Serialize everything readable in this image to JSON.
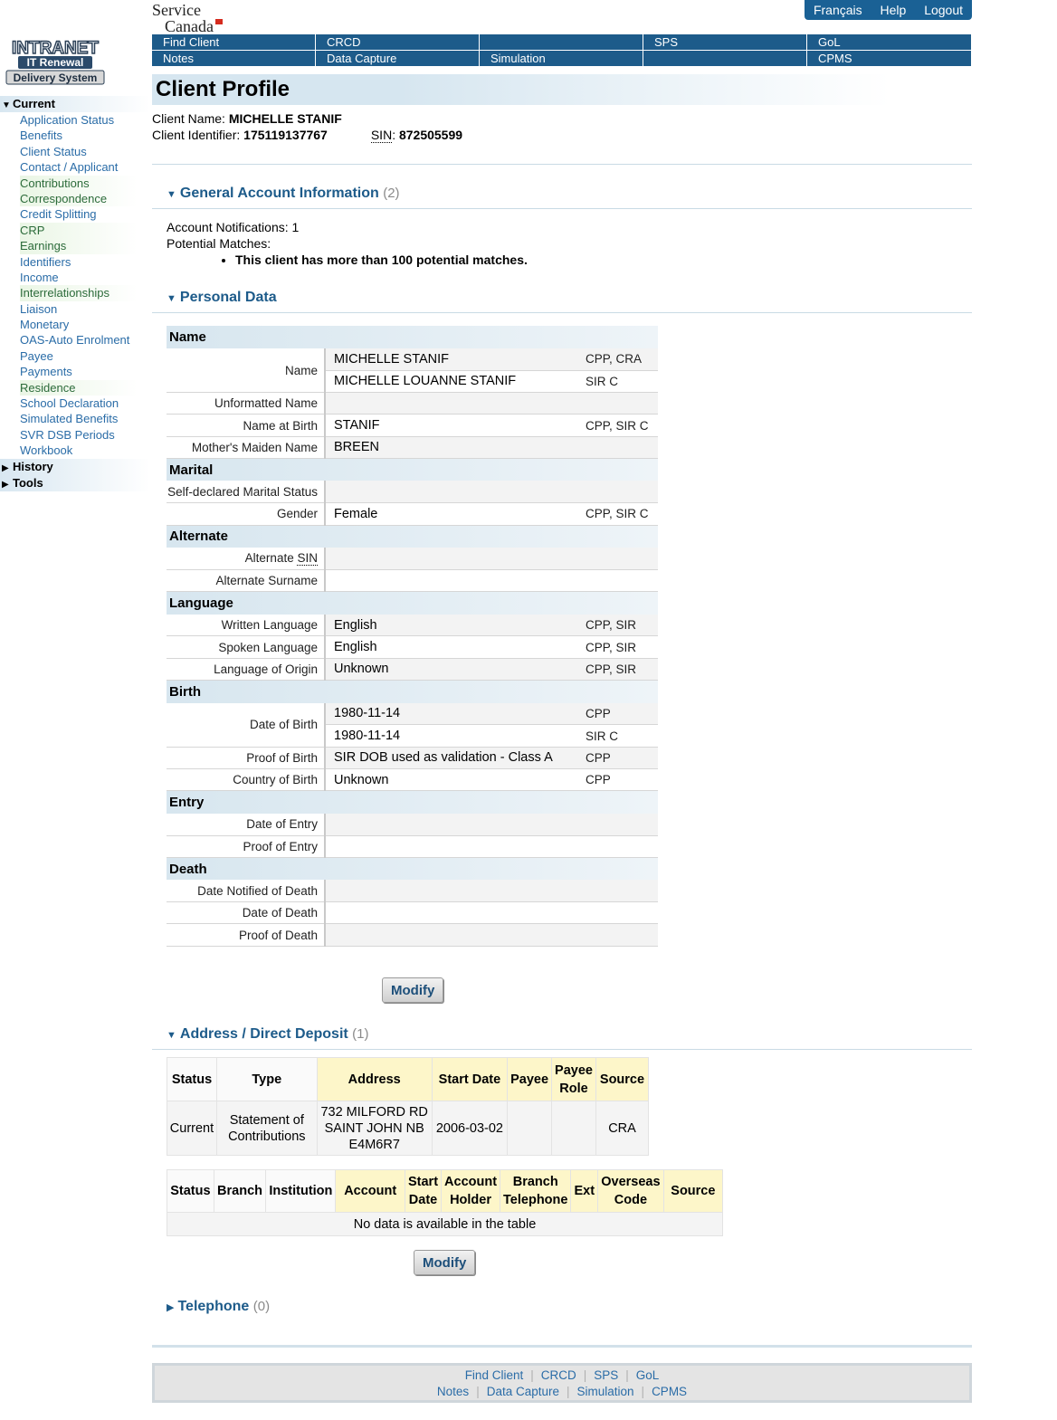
{
  "brand": {
    "line1": "Service",
    "line2": "Canada"
  },
  "logo": {
    "line1": "INTRANET",
    "line2": "IT Renewal",
    "line3": "Delivery System"
  },
  "toplinks": [
    "Français",
    "Help",
    "Logout"
  ],
  "nav": {
    "row1": [
      "Find Client",
      "CRCD",
      "",
      "SPS",
      "GoL"
    ],
    "row2": [
      "Notes",
      "Data Capture",
      "Simulation",
      "",
      "CPMS"
    ]
  },
  "sidebar": {
    "current_label": "Current",
    "items": [
      "Application Status",
      "Benefits",
      "Client Status",
      "Contact / Applicant",
      "Contributions",
      "Correspondence",
      "Credit Splitting",
      "CRP",
      "Earnings",
      "Identifiers",
      "Income",
      "Interrelationships",
      "Liaison",
      "Monetary",
      "OAS-Auto Enrolment",
      "Payee",
      "Payments",
      "Residence",
      "School Declaration",
      "Simulated Benefits",
      "SVR DSB Periods",
      "Workbook"
    ],
    "history_label": "History",
    "tools_label": "Tools"
  },
  "page_title": "Client Profile",
  "client": {
    "name_label": "Client Name:",
    "name": "MICHELLE STANIF",
    "id_label": "Client Identifier:",
    "id": "175119137767",
    "sin_label": "SIN",
    "sin": "872505599"
  },
  "general": {
    "title": "General Account Information",
    "count": "(2)",
    "notifications": "Account Notifications: 1",
    "matches_label": "Potential Matches:",
    "matches_item": "This client has more than 100 potential matches."
  },
  "personal": {
    "title": "Personal Data",
    "categories": {
      "name": "Name",
      "marital": "Marital",
      "alternate": "Alternate",
      "language": "Language",
      "birth": "Birth",
      "entry": "Entry",
      "death": "Death"
    },
    "labels": {
      "name": "Name",
      "unformatted": "Unformatted Name",
      "name_at_birth": "Name at Birth",
      "maiden": "Mother's Maiden Name",
      "marital": "Self-declared Marital Status",
      "gender": "Gender",
      "alt_sin_prefix": "Alternate",
      "alt_sin_abbr": "SIN",
      "alt_surname": "Alternate Surname",
      "written": "Written Language",
      "spoken": "Spoken Language",
      "origin": "Language of Origin",
      "dob": "Date of Birth",
      "proof_birth": "Proof of Birth",
      "country_birth": "Country of Birth",
      "date_entry": "Date of Entry",
      "proof_entry": "Proof of Entry",
      "date_notified": "Date Notified of Death",
      "date_death": "Date of Death",
      "proof_death": "Proof of Death"
    },
    "values": {
      "name1": "MICHELLE STANIF",
      "name1_src": "CPP, CRA",
      "name2": "MICHELLE LOUANNE STANIF",
      "name2_src": "SIR C",
      "name_at_birth": "STANIF",
      "name_at_birth_src": "CPP, SIR C",
      "maiden": "BREEN",
      "gender": "Female",
      "gender_src": "CPP, SIR C",
      "written": "English",
      "written_src": "CPP, SIR",
      "spoken": "English",
      "spoken_src": "CPP, SIR",
      "origin": "Unknown",
      "origin_src": "CPP, SIR",
      "dob1": "1980-11-14",
      "dob1_src": "CPP",
      "dob2": "1980-11-14",
      "dob2_src": "SIR C",
      "proof_birth": "SIR DOB used as validation - Class A",
      "proof_birth_src": "CPP",
      "country_birth": "Unknown",
      "country_birth_src": "CPP"
    },
    "modify_label": "Modify"
  },
  "address": {
    "title": "Address / Direct Deposit",
    "count": "(1)",
    "headers": [
      "Status",
      "Type",
      "Address",
      "Start Date",
      "Payee",
      "Payee Role",
      "Source"
    ],
    "row": {
      "status": "Current",
      "type": "Statement of Contributions",
      "address": [
        "732 MILFORD RD",
        "SAINT JOHN NB",
        "E4M6R7"
      ],
      "start_date": "2006-03-02",
      "payee": "",
      "payee_role": "",
      "source": "CRA"
    },
    "deposit_headers": [
      "Status",
      "Branch",
      "Institution",
      "Account",
      "Start Date",
      "Account Holder",
      "Branch Telephone",
      "Ext",
      "Overseas Code",
      "Source"
    ],
    "deposit_empty": "No data is available in the table",
    "modify_label": "Modify"
  },
  "telephone": {
    "title": "Telephone",
    "count": "(0)"
  },
  "footer": {
    "row1": [
      "Find Client",
      "CRCD",
      "SPS",
      "GoL"
    ],
    "row2": [
      "Notes",
      "Data Capture",
      "Simulation",
      "CPMS"
    ]
  },
  "colors": {
    "nav": "#1d5b8a",
    "accent": "#1d5b8a",
    "section_bg": "#d7e6ef",
    "header_yellow": "#fdf6c9"
  }
}
